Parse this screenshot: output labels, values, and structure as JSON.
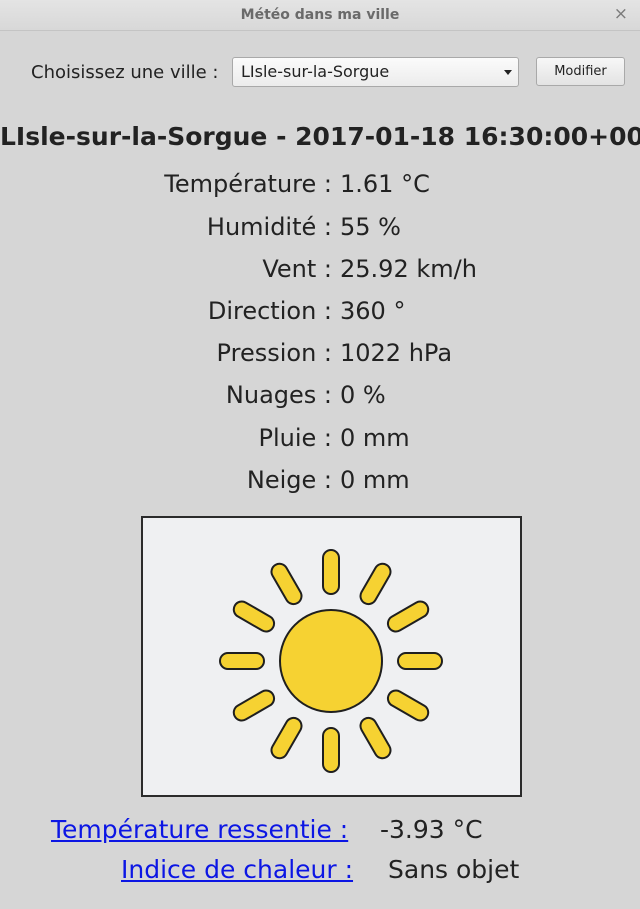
{
  "window": {
    "title": "Météo dans ma ville",
    "close_glyph": "×"
  },
  "controls": {
    "city_label": "Choisissez une ville :",
    "city_selected": "LIsle-sur-la-Sorgue",
    "modify_button": "Modifier"
  },
  "heading": "LIsle-sur-la-Sorgue - 2017-01-18 16:30:00+00",
  "metrics": [
    {
      "label": "Température :",
      "value": "1.61 °C"
    },
    {
      "label": "Humidité :",
      "value": "55 %"
    },
    {
      "label": "Vent :",
      "value": "25.92 km/h"
    },
    {
      "label": "Direction :",
      "value": "360 °"
    },
    {
      "label": "Pression :",
      "value": "1022 hPa"
    },
    {
      "label": "Nuages :",
      "value": "0 %"
    },
    {
      "label": "Pluie :",
      "value": "0 mm"
    },
    {
      "label": "Neige :",
      "value": "0 mm"
    }
  ],
  "weather_icon": {
    "name": "sun-icon",
    "color": "#f6d232",
    "outline": "#1f1f1f"
  },
  "extra": {
    "feels_like_label": "Température ressentie :",
    "feels_like_value": "-3.93 °C",
    "heat_index_label": "Indice de chaleur :",
    "heat_index_value": "Sans objet"
  },
  "colors": {
    "link": "#0c16e4",
    "background": "#d6d6d6"
  }
}
